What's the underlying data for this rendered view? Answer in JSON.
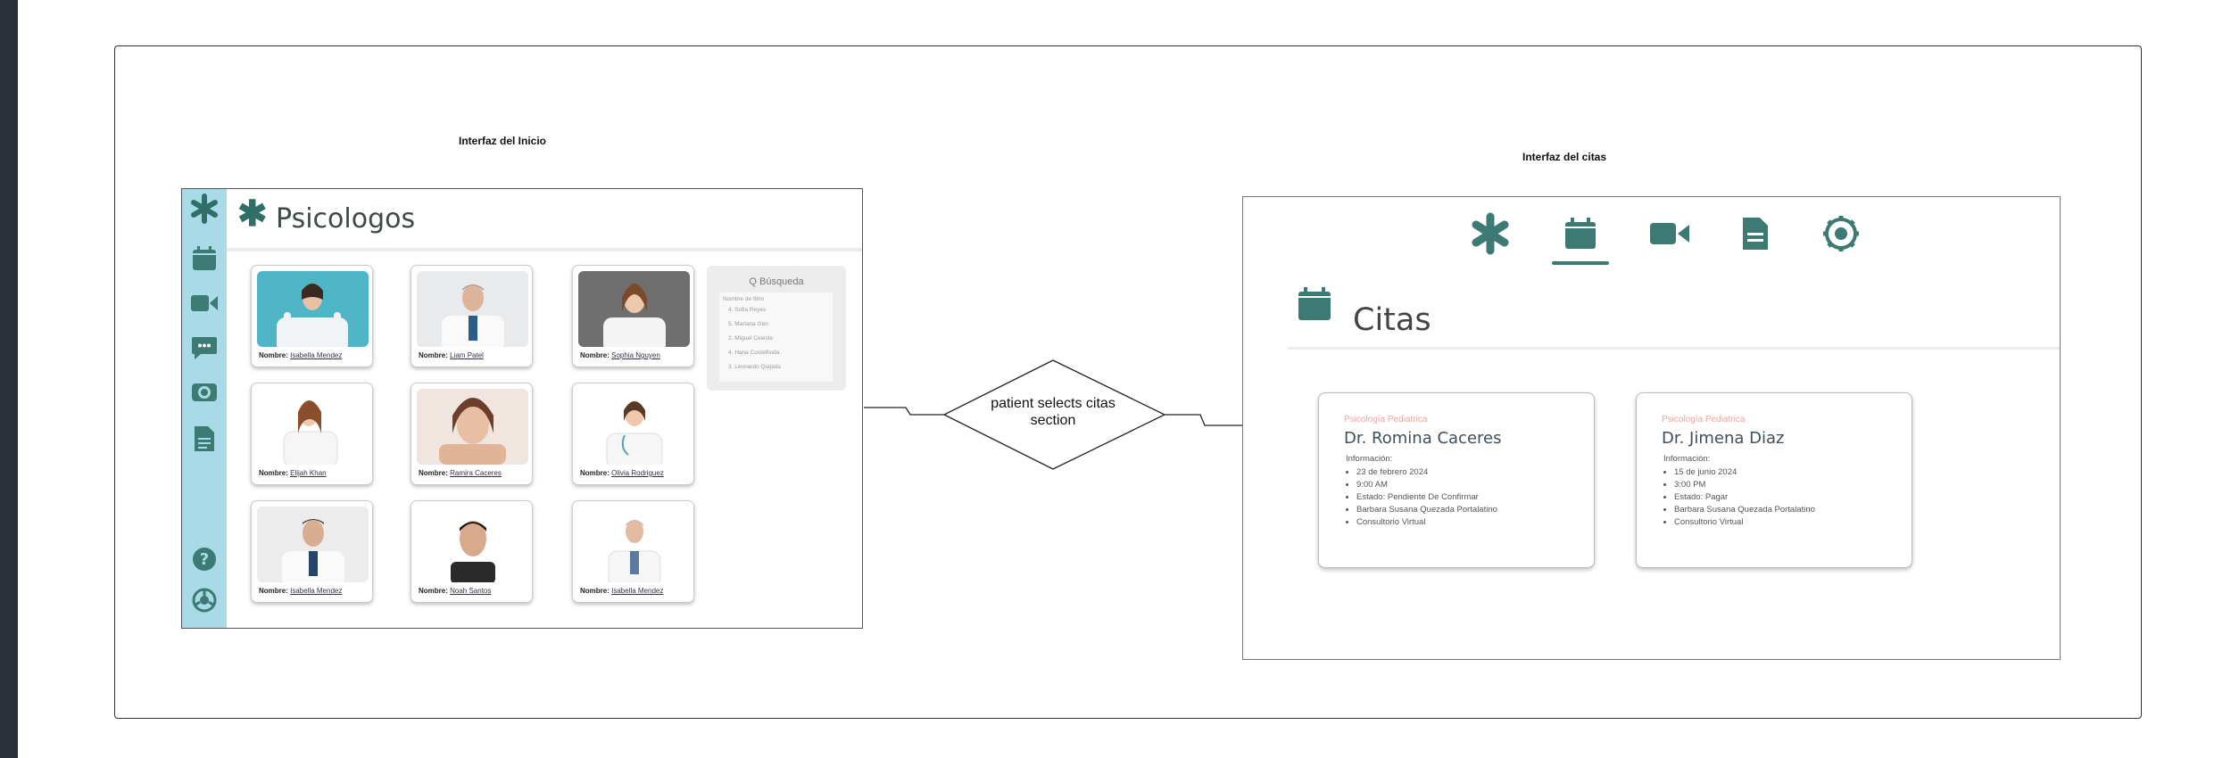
{
  "labels": {
    "inicio": "Interfaz del Inicio",
    "citas": "Interfaz del citas"
  },
  "decision": {
    "line1": "patient selects citas",
    "line2": "section"
  },
  "inicio_screen": {
    "title": "Psicologos",
    "sidebar_icons": [
      "asterisk-icon",
      "calendar-icon",
      "video-icon",
      "chat-icon",
      "settings-icon",
      "document-icon",
      "help-icon",
      "gear-icon"
    ],
    "name_prefix": "Nombre:",
    "psychologists": [
      {
        "name": "Isabella Mendez"
      },
      {
        "name": "Liam Patel"
      },
      {
        "name": "Sophia Nguyen"
      },
      {
        "name": "Elijah Khan"
      },
      {
        "name": "Ramira Caceres"
      },
      {
        "name": "Olivia Rodriguez"
      },
      {
        "name": "Isabella Mendez"
      },
      {
        "name": "Noah Santos"
      },
      {
        "name": "Isabella Mendez"
      }
    ],
    "search": {
      "title": "Q Búsqueda",
      "subtitle": "Nombre de filtro",
      "items": [
        "Sofia Reyes",
        "Mariana Gen",
        "Miguel Celeste",
        "Hana Costelhuda",
        "Leonardo Quijada"
      ]
    }
  },
  "citas_screen": {
    "title": "Citas",
    "nav_icons": [
      "asterisk-icon",
      "calendar-icon",
      "video-icon",
      "document-icon",
      "gear-icon"
    ],
    "appointments": [
      {
        "specialty": "Psicología Pediatrica",
        "doctor": "Dr. Romina Caceres",
        "info_label": "Información:",
        "details": [
          "23 de febrero 2024",
          "9:00 AM",
          "Estado: Pendiente De Confirmar",
          "Barbara Susana Quezada Portalatino",
          "Consultorio Virtual"
        ]
      },
      {
        "specialty": "Psicología Pediatrica",
        "doctor": "Dr. Jimena Diaz",
        "info_label": "Información:",
        "details": [
          "15 de junio 2024",
          "3:00 PM",
          "Estado: Pagar",
          "Barbara Susana Quezada Portalatino",
          "Consultorio Virtual"
        ]
      }
    ]
  },
  "colors": {
    "primary": "#3d7a73",
    "sidebar": "#a9dae8",
    "specialty_text": "#f0a39a"
  }
}
